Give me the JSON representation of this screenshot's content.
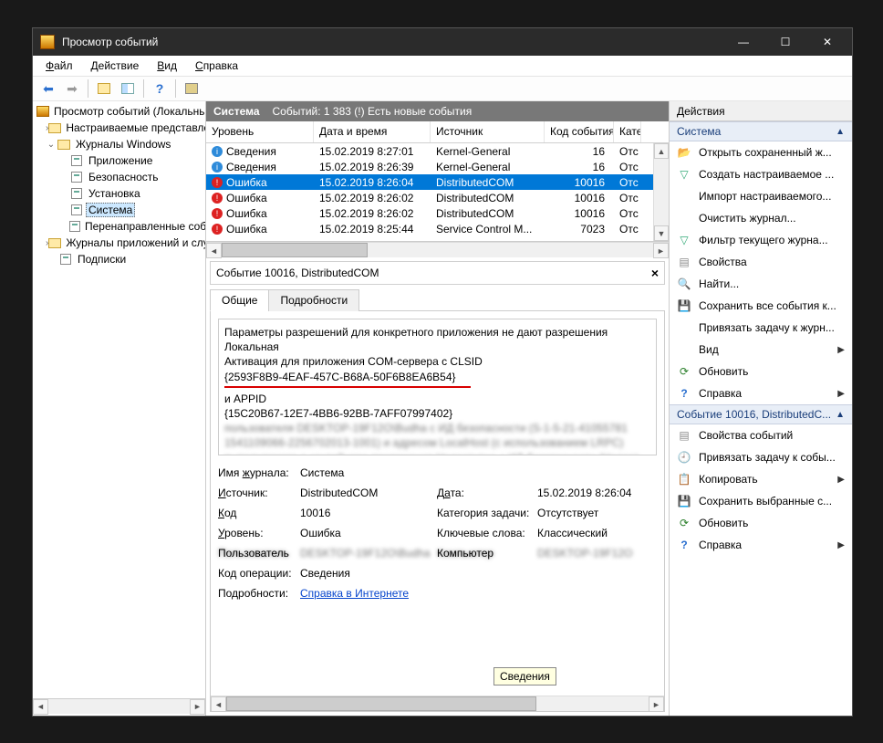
{
  "window": {
    "title": "Просмотр событий"
  },
  "menu": {
    "file_pre": "Ф",
    "file": "айл",
    "action_pre": "Д",
    "action": "ействие",
    "view_pre": "В",
    "view": "ид",
    "help_pre": "С",
    "help": "правка"
  },
  "tree": {
    "root": "Просмотр событий (Локальный)",
    "custom": "Настраиваемые представления",
    "winlogs": "Журналы Windows",
    "app": "Приложение",
    "security": "Безопасность",
    "setup": "Установка",
    "system": "Система",
    "forwarded": "Перенаправленные события",
    "appservices": "Журналы приложений и служб",
    "subs": "Подписки"
  },
  "centerHeader": {
    "title": "Система",
    "count": "Событий: 1 383 (!) Есть новые события"
  },
  "columns": {
    "level": "Уровень",
    "datetime": "Дата и время",
    "source": "Источник",
    "code": "Код события",
    "cat": "Категория"
  },
  "rows": [
    {
      "icon": "info",
      "level": "Сведения",
      "dt": "15.02.2019 8:27:01",
      "src": "Kernel-General",
      "code": "16",
      "cat": "Отс"
    },
    {
      "icon": "info",
      "level": "Сведения",
      "dt": "15.02.2019 8:26:39",
      "src": "Kernel-General",
      "code": "16",
      "cat": "Отс"
    },
    {
      "icon": "err",
      "level": "Ошибка",
      "dt": "15.02.2019 8:26:04",
      "src": "DistributedCOM",
      "code": "10016",
      "cat": "Отс",
      "sel": true
    },
    {
      "icon": "err",
      "level": "Ошибка",
      "dt": "15.02.2019 8:26:02",
      "src": "DistributedCOM",
      "code": "10016",
      "cat": "Отс"
    },
    {
      "icon": "err",
      "level": "Ошибка",
      "dt": "15.02.2019 8:26:02",
      "src": "DistributedCOM",
      "code": "10016",
      "cat": "Отс"
    },
    {
      "icon": "err",
      "level": "Ошибка",
      "dt": "15.02.2019 8:25:44",
      "src": "Service Control M...",
      "code": "7023",
      "cat": "Отс"
    }
  ],
  "detail": {
    "title": "Событие 10016, DistributedCOM",
    "tab_general": "Общие",
    "tab_details": "Подробности",
    "line1": "Параметры разрешений для конкретного приложения не дают разрешения Локальная",
    "line2": "Активация для приложения COM-сервера с CLSID",
    "clsid": "{2593F8B9-4EAF-457C-B68A-50F6B8EA6B54}",
    "appid_lbl": "и APPID",
    "appid": "{15C20B67-12E7-4BB6-92BB-7AFF07997402}",
    "p_logname_l": "Имя журнала:",
    "p_logname_v": "Система",
    "p_source_l": "Источник:",
    "p_source_v": "DistributedCOM",
    "p_date_l": "Дата:",
    "p_date_v": "15.02.2019 8:26:04",
    "p_code_l": "Код",
    "p_code_v": "10016",
    "p_taskcat_l": "Категория задачи:",
    "p_taskcat_v": "Отсутствует",
    "p_level_l": "Уровень:",
    "p_level_v": "Ошибка",
    "p_keywords_l": "Ключевые слова:",
    "p_keywords_v": "Классический",
    "p_opcode_l": "Код операции:",
    "p_opcode_v": "Сведения",
    "p_details_l": "Подробности:",
    "p_details_link": "Справка в Интернете",
    "tooltip": "Сведения"
  },
  "actions": {
    "title": "Действия",
    "group1": "Система",
    "open_saved": "Открыть сохраненный ж...",
    "create_custom": "Создать настраиваемое ...",
    "import_custom": "Импорт настраиваемого...",
    "clear_log": "Очистить журнал...",
    "filter_cur": "Фильтр текущего журна...",
    "props": "Свойства",
    "find": "Найти...",
    "save_all": "Сохранить все события к...",
    "attach": "Привязать задачу к журн...",
    "view": "Вид",
    "refresh": "Обновить",
    "help": "Справка",
    "group2": "Событие 10016, DistributedC...",
    "ev_props": "Свойства событий",
    "ev_attach": "Привязать задачу к собы...",
    "copy": "Копировать",
    "save_sel": "Сохранить выбранные с...",
    "refresh2": "Обновить",
    "help2": "Справка"
  }
}
